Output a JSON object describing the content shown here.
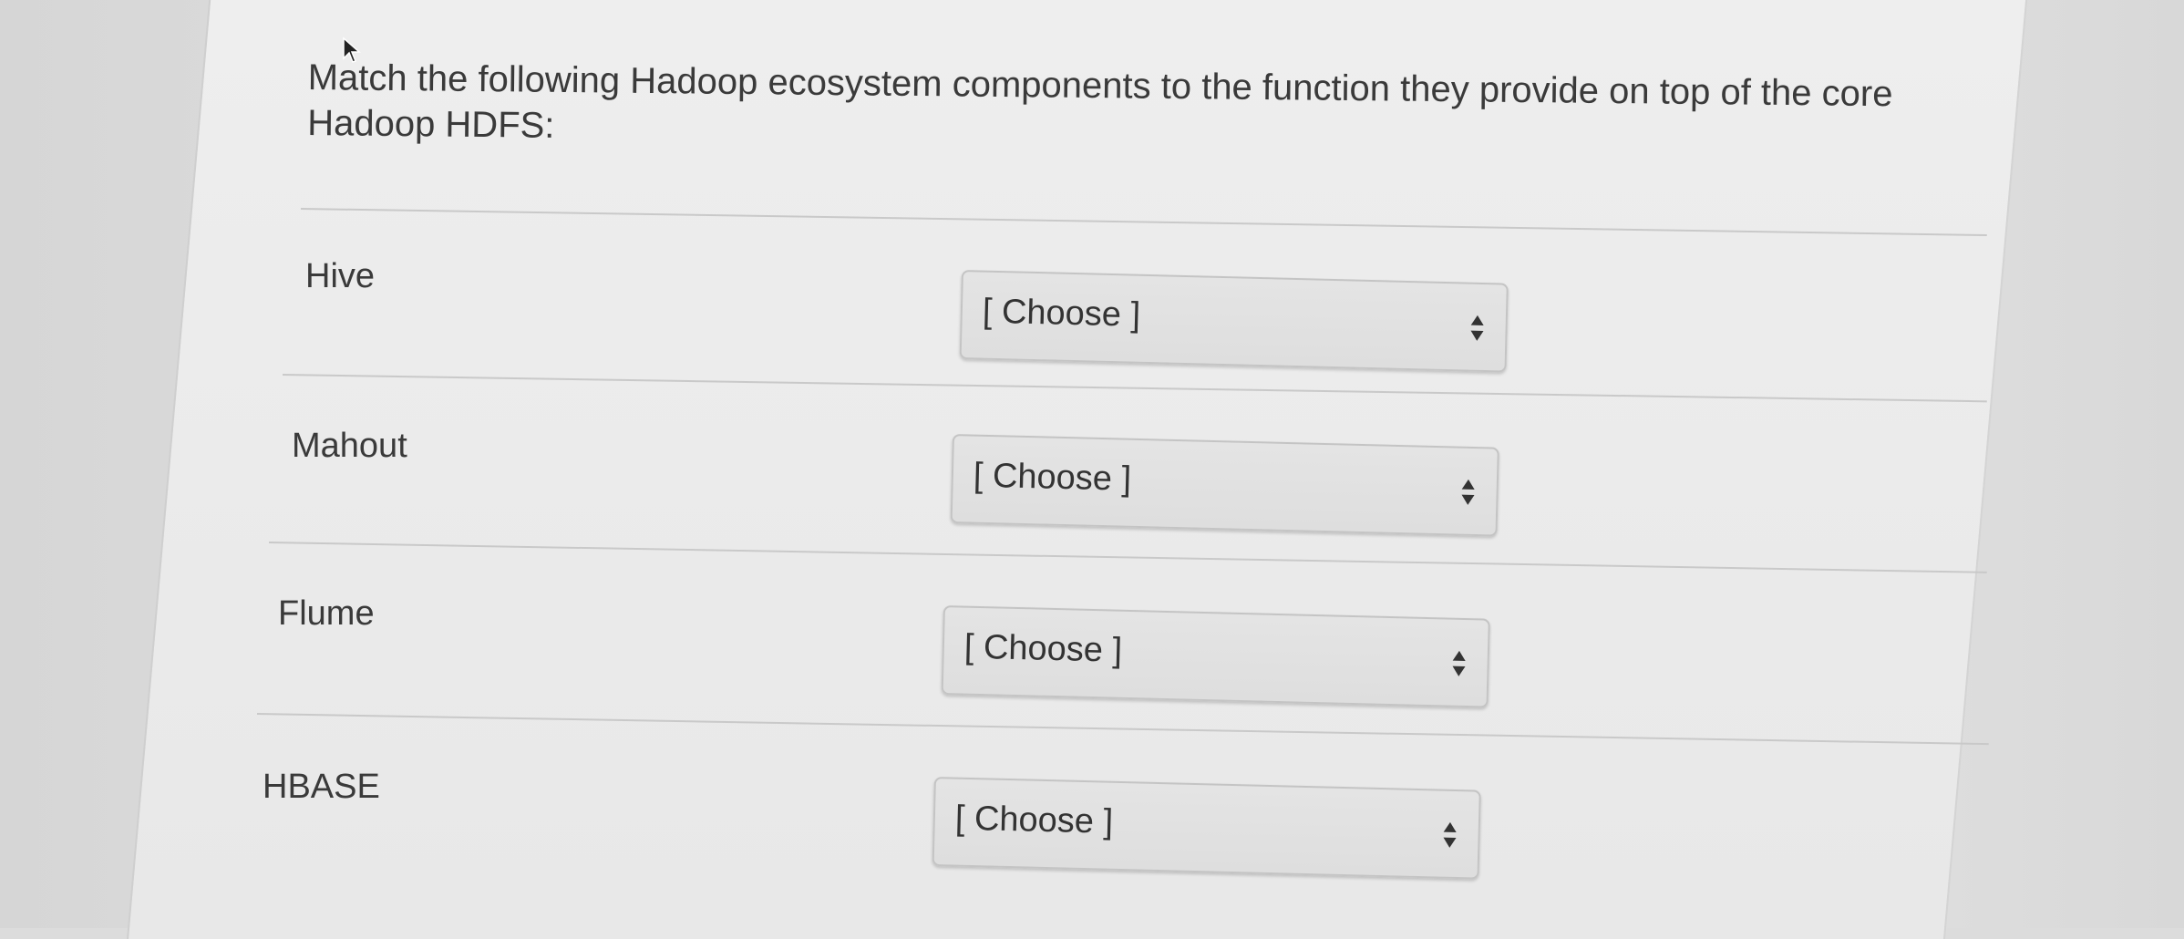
{
  "question": {
    "text": "Match the following Hadoop ecosystem components to the function they provide on top of the core Hadoop HDFS:"
  },
  "rows": [
    {
      "label": "Hive",
      "selected": "[ Choose ]"
    },
    {
      "label": "Mahout",
      "selected": "[ Choose ]"
    },
    {
      "label": "Flume",
      "selected": "[ Choose ]"
    },
    {
      "label": "HBASE",
      "selected": "[ Choose ]"
    }
  ],
  "icons": {
    "select_arrows": "up-down-arrows-icon",
    "cursor": "mouse-pointer-icon"
  }
}
